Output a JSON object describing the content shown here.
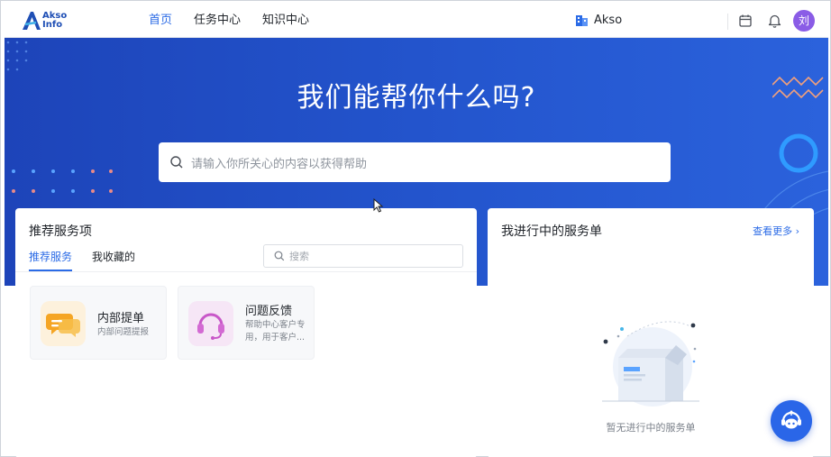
{
  "header": {
    "logo_line1": "Akso",
    "logo_line2": "Info",
    "nav": [
      {
        "label": "首页",
        "active": true
      },
      {
        "label": "任务中心",
        "active": false
      },
      {
        "label": "知识中心",
        "active": false
      }
    ],
    "tenant_label": "Akso",
    "avatar_text": "刘"
  },
  "hero": {
    "title": "我们能帮你什么吗?",
    "search_placeholder": "请输入你所关心的内容以获得帮助"
  },
  "recommended": {
    "title": "推荐服务项",
    "tabs": [
      {
        "label": "推荐服务",
        "active": true
      },
      {
        "label": "我收藏的",
        "active": false
      }
    ],
    "search_placeholder": "搜索",
    "services": [
      {
        "name": "内部提单",
        "desc": "内部问题提报",
        "icon": "chat-bubble-icon"
      },
      {
        "name": "问题反馈",
        "desc": "帮助中心客户专用，用于客户...",
        "icon": "headset-icon"
      }
    ]
  },
  "my_tickets": {
    "title": "我进行中的服务单",
    "more_label": "查看更多",
    "empty_text": "暂无进行中的服务单"
  },
  "colors": {
    "primary": "#2b6be6",
    "hero": "#1d44b9",
    "avatar": "#8a5ce6"
  }
}
